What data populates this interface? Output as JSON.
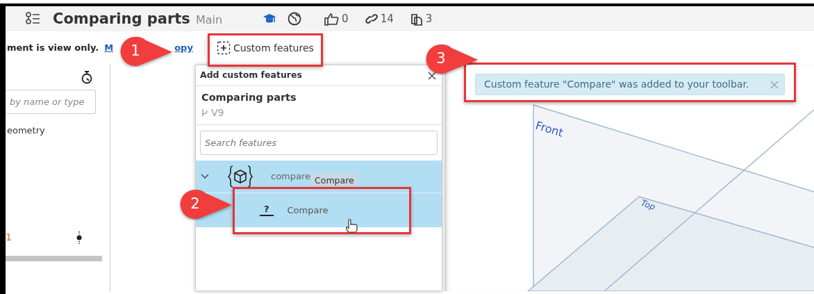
{
  "header": {
    "title": "Comparing parts",
    "branch": "Main",
    "likes": "0",
    "links": "14",
    "copies": "3"
  },
  "toolbar": {
    "notice": "ment is view only.",
    "link_parts": [
      "M",
      "opy"
    ],
    "button": "Custom features"
  },
  "feature_panel": {
    "search": {
      "placeholder": "by name or type"
    },
    "items": [
      {
        "label": "eometry",
        "kind": "text"
      },
      {
        "label": "1",
        "kind": "count"
      }
    ]
  },
  "dialog": {
    "title": "Add custom features",
    "document": "Comparing parts",
    "version": "V9",
    "search": {
      "placeholder": "Search features"
    },
    "tree": [
      {
        "label": "compare",
        "expanded": true,
        "selected": true,
        "tooltip": "Compare",
        "children": [
          {
            "icon": "?",
            "label": "Compare",
            "selected": true
          }
        ]
      }
    ]
  },
  "toast": {
    "message": "Custom feature \"Compare\" was added to your toolbar."
  },
  "viewport": {
    "planes": [
      "Front",
      "Top"
    ]
  },
  "callouts": [
    "1",
    "2",
    "3"
  ]
}
